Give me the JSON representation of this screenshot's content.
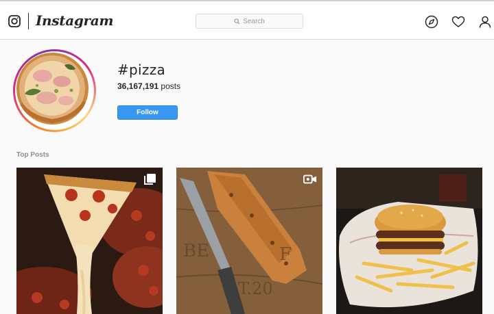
{
  "app": {
    "wordmark": "Instagram",
    "icons": [
      "instagram-camera-icon",
      "search-icon",
      "compass-icon",
      "heart-icon",
      "profile-icon"
    ]
  },
  "search": {
    "placeholder": "Search"
  },
  "hashtag": {
    "title": "#pizza",
    "post_count": "36,167,191",
    "posts_word": "posts",
    "follow_label": "Follow"
  },
  "section": {
    "top_posts_label": "Top Posts"
  },
  "posts": [
    {
      "kind": "carousel",
      "badge_icon": "carousel-icon",
      "subject": "pizza slice cheese pull"
    },
    {
      "kind": "video",
      "badge_icon": "video-icon",
      "subject": "crispy pizza crust with knife on wooden board"
    },
    {
      "kind": "photo",
      "subject": "burger with fries in paper"
    }
  ],
  "colors": {
    "follow_button": "#3897f0",
    "avatar_ring_start": "#f58529",
    "avatar_ring_end": "#dd2a7b",
    "text_primary": "#262626",
    "text_muted": "#8e8e8e"
  }
}
